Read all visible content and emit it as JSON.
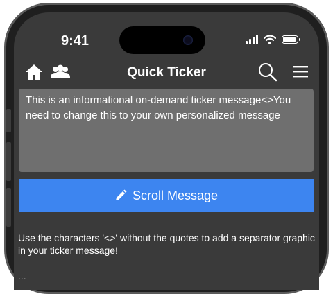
{
  "status_bar": {
    "time": "9:41"
  },
  "header": {
    "title": "Quick Ticker"
  },
  "message": {
    "text": "This is an informational on-demand ticker message<>You need to change this to your own personalized message"
  },
  "scroll_button": {
    "label": "Scroll Message"
  },
  "help": {
    "text": "Use the characters '<>' without the quotes to add a separator graphic in your ticker message!",
    "text2": "..."
  },
  "colors": {
    "accent": "#3d85f0",
    "background": "#3a3a3a",
    "message_box": "#6f6f6f"
  },
  "icons": [
    "home-icon",
    "users-icon",
    "search-icon",
    "menu-icon",
    "pencil-icon",
    "wifi-icon",
    "signal-icon",
    "battery-icon"
  ]
}
